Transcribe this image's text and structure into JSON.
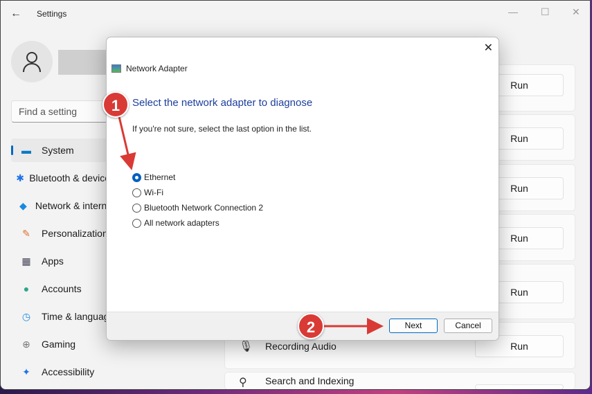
{
  "window": {
    "title": "Settings",
    "minimize": "—",
    "maximize": "☐",
    "close": "✕"
  },
  "search": {
    "placeholder": "Find a setting"
  },
  "sidebar": {
    "items": [
      {
        "label": "System",
        "icon": "▬"
      },
      {
        "label": "Bluetooth & devices",
        "icon": "✱"
      },
      {
        "label": "Network & internet",
        "icon": "◆"
      },
      {
        "label": "Personalization",
        "icon": "✎"
      },
      {
        "label": "Apps",
        "icon": "▦"
      },
      {
        "label": "Accounts",
        "icon": "●"
      },
      {
        "label": "Time & language",
        "icon": "◷"
      },
      {
        "label": "Gaming",
        "icon": "⊕"
      },
      {
        "label": "Accessibility",
        "icon": "✦"
      }
    ]
  },
  "troubleshooters": {
    "run_label": "Run",
    "items": [
      {
        "label": "Recording Audio"
      },
      {
        "label": "Search and Indexing"
      }
    ]
  },
  "dialog": {
    "title": "Network Adapter",
    "close": "✕",
    "heading": "Select the network adapter to diagnose",
    "subtext": "If you're not sure, select the last option in the list.",
    "options": [
      {
        "label": "Ethernet",
        "selected": true
      },
      {
        "label": "Wi-Fi",
        "selected": false
      },
      {
        "label": "Bluetooth Network Connection 2",
        "selected": false
      },
      {
        "label": "All network adapters",
        "selected": false
      }
    ],
    "next": "Next",
    "cancel": "Cancel"
  },
  "annotations": {
    "step1": "1",
    "step2": "2",
    "color": "#d93a35"
  }
}
